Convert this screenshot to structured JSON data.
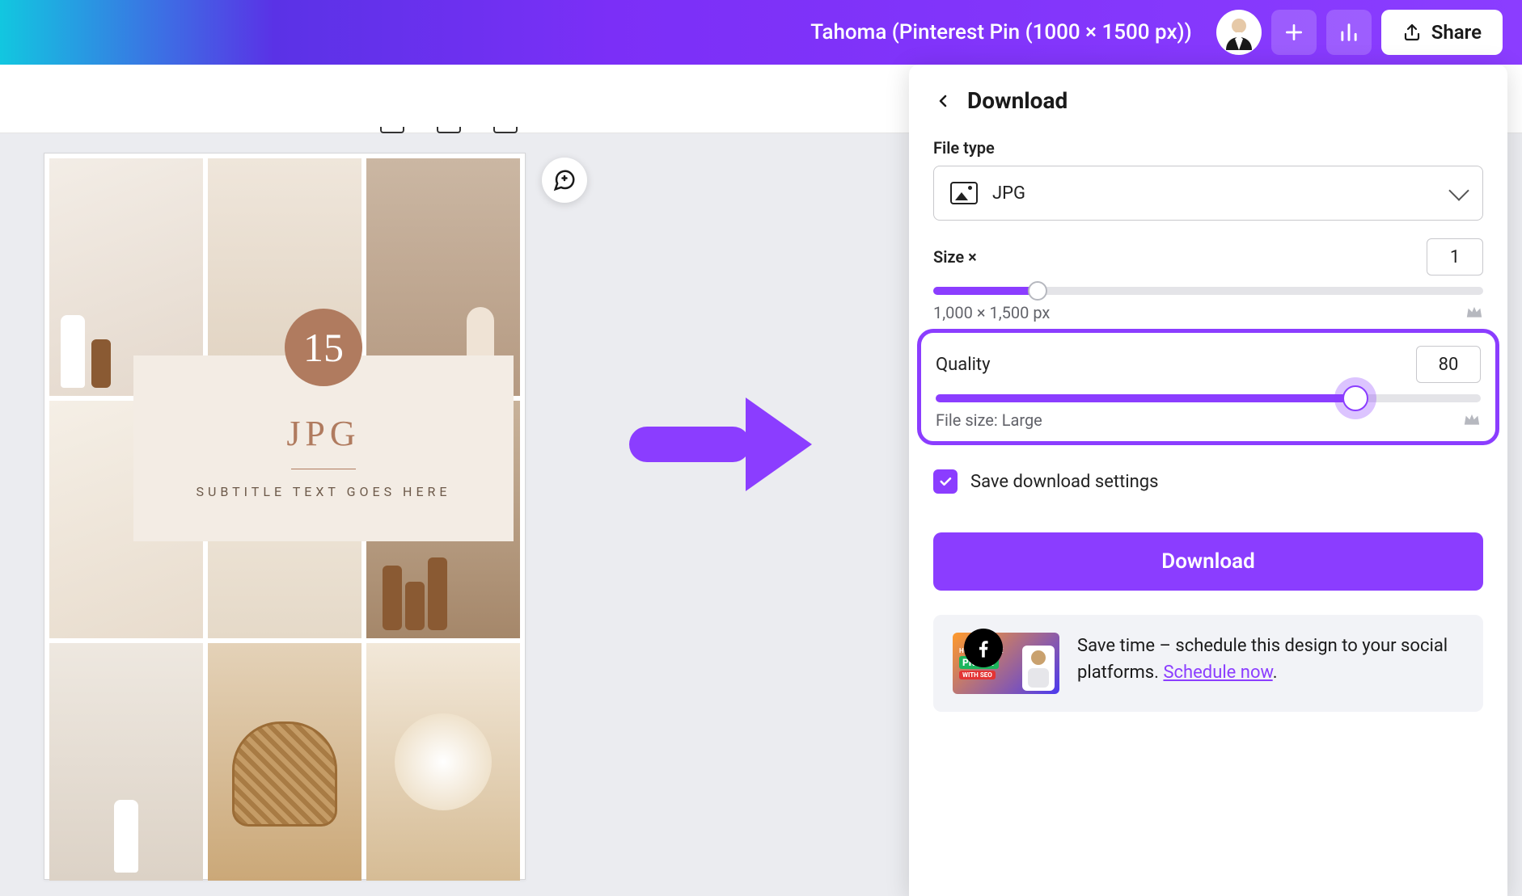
{
  "header": {
    "title": "Tahoma (Pinterest Pin (1000 × 1500 px))",
    "share_label": "Share"
  },
  "canvas": {
    "badge_number": "15",
    "overlay_title": "JPG",
    "overlay_subtitle": "SUBTITLE TEXT GOES HERE"
  },
  "panel": {
    "title": "Download",
    "file_type_label": "File type",
    "file_type_value": "JPG",
    "size_label": "Size ×",
    "size_value": "1",
    "size_slider_percent": 19,
    "dimensions": "1,000 × 1,500 px",
    "quality_label": "Quality",
    "quality_value": "80",
    "quality_slider_percent": 77,
    "file_size": "File size: Large",
    "save_settings_label": "Save download settings",
    "save_settings_checked": true,
    "download_button": "Download",
    "promo_text": "Save time – schedule this design to your social platforms. ",
    "promo_link": "Schedule now",
    "promo_thumb": {
      "t1": "HOW TO MAKE",
      "t2": "PROFIT",
      "t3": "WITH SEO"
    }
  }
}
